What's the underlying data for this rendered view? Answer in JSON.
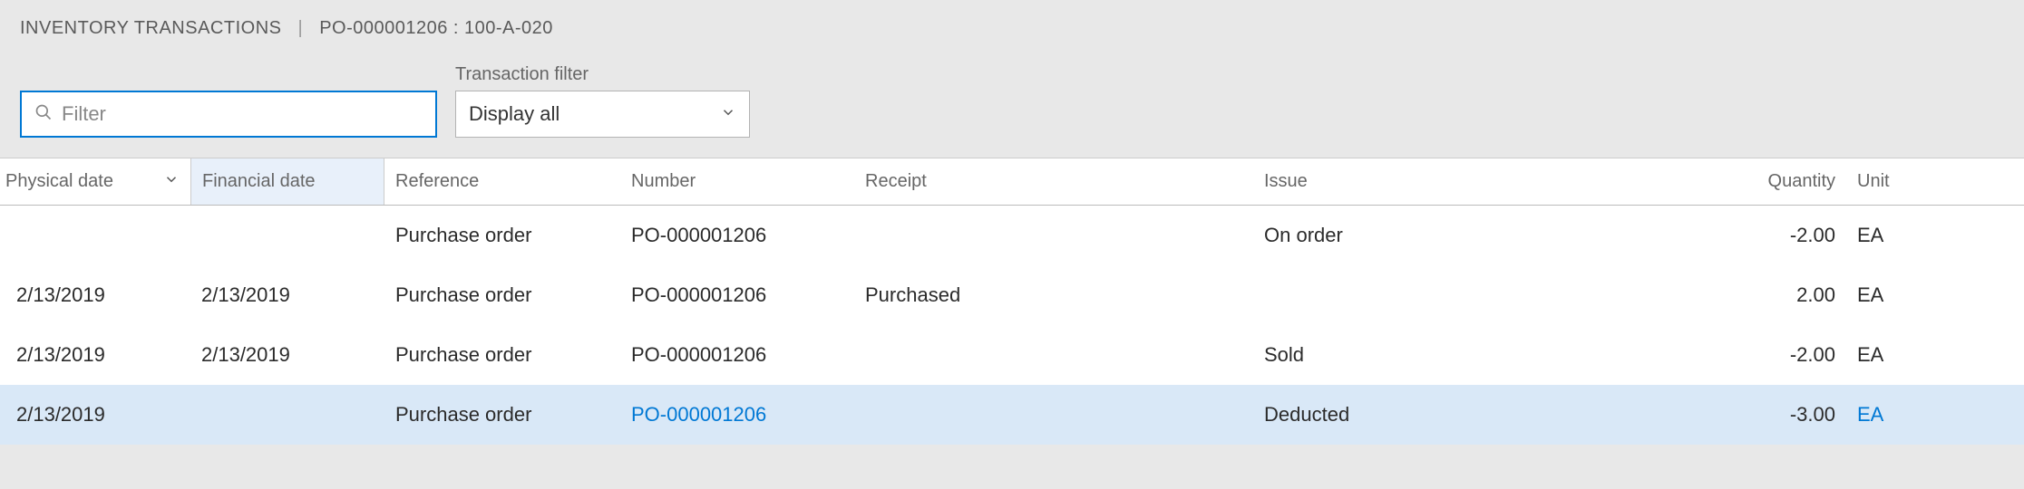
{
  "header": {
    "title": "INVENTORY TRANSACTIONS",
    "context": "PO-000001206 : 100-A-020"
  },
  "filter": {
    "placeholder": "Filter",
    "value": ""
  },
  "transaction_filter": {
    "label": "Transaction filter",
    "selected": "Display all"
  },
  "columns": {
    "physical_date": "Physical date",
    "financial_date": "Financial date",
    "reference": "Reference",
    "number": "Number",
    "receipt": "Receipt",
    "issue": "Issue",
    "quantity": "Quantity",
    "unit": "Unit"
  },
  "rows": [
    {
      "physical_date": "",
      "financial_date": "",
      "reference": "Purchase order",
      "number": "PO-000001206",
      "receipt": "",
      "issue": "On order",
      "quantity": "-2.00",
      "unit": "EA",
      "selected": false
    },
    {
      "physical_date": "2/13/2019",
      "financial_date": "2/13/2019",
      "reference": "Purchase order",
      "number": "PO-000001206",
      "receipt": "Purchased",
      "issue": "",
      "quantity": "2.00",
      "unit": "EA",
      "selected": false
    },
    {
      "physical_date": "2/13/2019",
      "financial_date": "2/13/2019",
      "reference": "Purchase order",
      "number": "PO-000001206",
      "receipt": "",
      "issue": "Sold",
      "quantity": "-2.00",
      "unit": "EA",
      "selected": false
    },
    {
      "physical_date": "2/13/2019",
      "financial_date": "",
      "reference": "Purchase order",
      "number": "PO-000001206",
      "receipt": "",
      "issue": "Deducted",
      "quantity": "-3.00",
      "unit": "EA",
      "selected": true
    }
  ]
}
